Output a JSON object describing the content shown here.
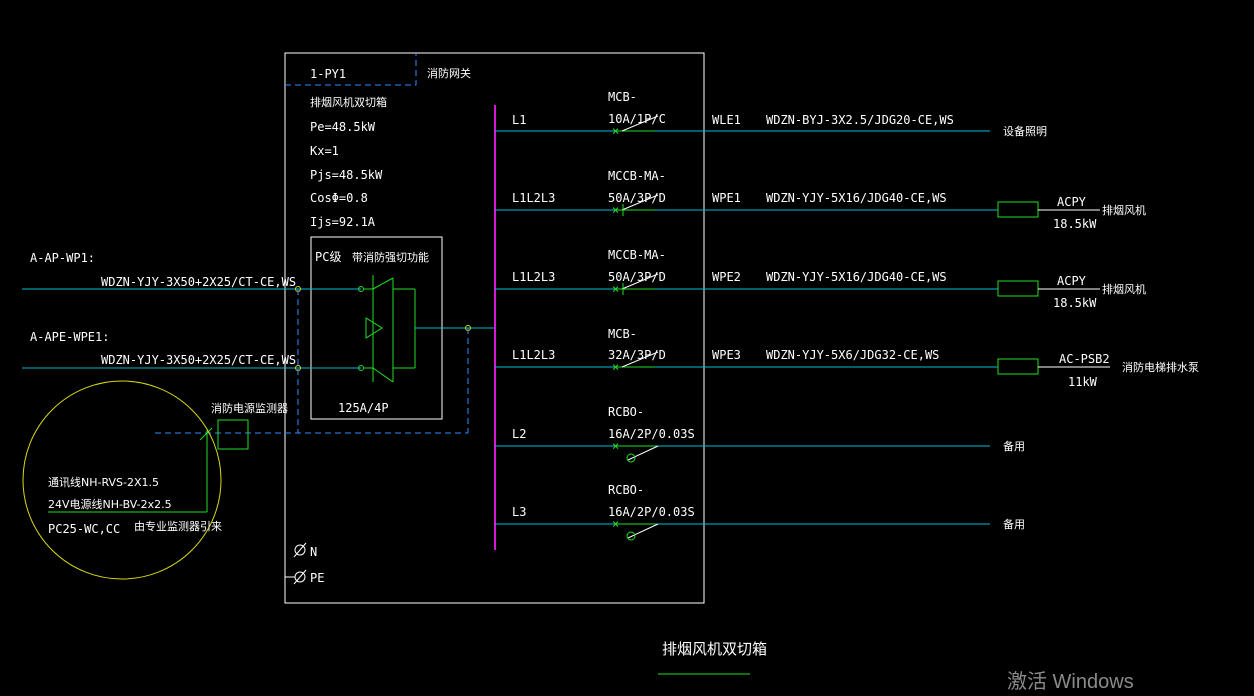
{
  "panel": {
    "id": "1-PY1",
    "note": "消防网关",
    "name": "排烟风机双切箱",
    "params": [
      "Pe=48.5kW",
      "Kx=1",
      "Pjs=48.5kW",
      "CosΦ=0.8",
      "Ijs=92.1A"
    ],
    "ats_label": "PC级",
    "ats_desc": "带消防强切功能",
    "ats_rating": "125A/4P",
    "terminal_n": "N",
    "terminal_pe": "PE"
  },
  "incoming": [
    {
      "source": "A-AP-WP1:",
      "cable": "WDZN-YJY-3X50+2X25/CT-CE,WS"
    },
    {
      "source": "A-APE-WPE1:",
      "cable": "WDZN-YJY-3X50+2X25/CT-CE,WS"
    }
  ],
  "fire_monitor": {
    "label": "消防电源监测器",
    "lines": [
      "通讯线NH-RVS-2X1.5",
      "24V电源线NH-BV-2x2.5",
      "PC25-WC,CC"
    ],
    "note": "由专业监测器引来"
  },
  "circuits": [
    {
      "phase": "L1",
      "breaker": [
        "MCB-",
        "10A/1P/C"
      ],
      "circuit": "WLE1",
      "cable": "WDZN-BYJ-3X2.5/JDG20-CE,WS",
      "load_name": "",
      "load_power": "",
      "desc": "设备照明"
    },
    {
      "phase": "L1L2L3",
      "breaker": [
        "MCCB-MA-",
        "50A/3P/D"
      ],
      "circuit": "WPE1",
      "cable": "WDZN-YJY-5X16/JDG40-CE,WS",
      "load_name": "ACPY",
      "load_power": "18.5kW",
      "desc": "排烟风机"
    },
    {
      "phase": "L1L2L3",
      "breaker": [
        "MCCB-MA-",
        "50A/3P/D"
      ],
      "circuit": "WPE2",
      "cable": "WDZN-YJY-5X16/JDG40-CE,WS",
      "load_name": "ACPY",
      "load_power": "18.5kW",
      "desc": "排烟风机"
    },
    {
      "phase": "L1L2L3",
      "breaker": [
        "MCB-",
        "32A/3P/D"
      ],
      "circuit": "WPE3",
      "cable": "WDZN-YJY-5X6/JDG32-CE,WS",
      "load_name": "AC-PSB2",
      "load_power": "11kW",
      "desc": "消防电梯排水泵"
    },
    {
      "phase": "L2",
      "breaker": [
        "RCBO-",
        "16A/2P/0.03S"
      ],
      "circuit": "",
      "cable": "",
      "load_name": "",
      "load_power": "",
      "desc": "备用"
    },
    {
      "phase": "L3",
      "breaker": [
        "RCBO-",
        "16A/2P/0.03S"
      ],
      "circuit": "",
      "cable": "",
      "load_name": "",
      "load_power": "",
      "desc": "备用"
    }
  ],
  "footer_title": "排烟风机双切箱",
  "watermark": "激活 Windows",
  "colors": {
    "background": "#000000",
    "wire": "#00bcd4",
    "breaker": "#21e021",
    "bus": "#d21ad2",
    "frame": "#ffffff",
    "dashed": "#2f8cff",
    "circle": "#d8d818"
  }
}
